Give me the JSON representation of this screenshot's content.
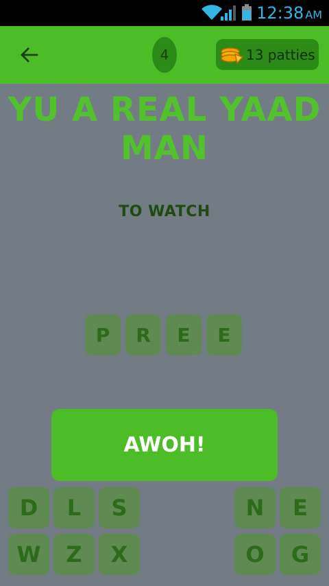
{
  "status_bar": {
    "time": "12:38",
    "ampm": "AM",
    "icons": [
      "wifi-icon",
      "signal-icon",
      "battery-icon"
    ]
  },
  "app_bar": {
    "back_icon": "arrow-left-icon",
    "level": "4",
    "coins_icon": "patty-stack-icon",
    "coins_label": "13 patties"
  },
  "puzzle": {
    "headline_line1": "YU A REAL YAAD",
    "headline_line2": "MAN",
    "hint": "TO WATCH",
    "answer_letters": [
      "P",
      "R",
      "E",
      "E"
    ]
  },
  "actions": {
    "confirm_label": "AWOH!"
  },
  "keyboard": {
    "row1": [
      "D",
      "L",
      "S",
      "N",
      "E"
    ],
    "row2": [
      "W",
      "Z",
      "X",
      "O",
      "G"
    ]
  },
  "colors": {
    "background": "#737b85",
    "app_bar": "#4cbd27",
    "accent_dark": "#2c8a17",
    "tile": "#5f8a52",
    "headline": "#52c22c",
    "status_accent": "#33b5e5"
  }
}
